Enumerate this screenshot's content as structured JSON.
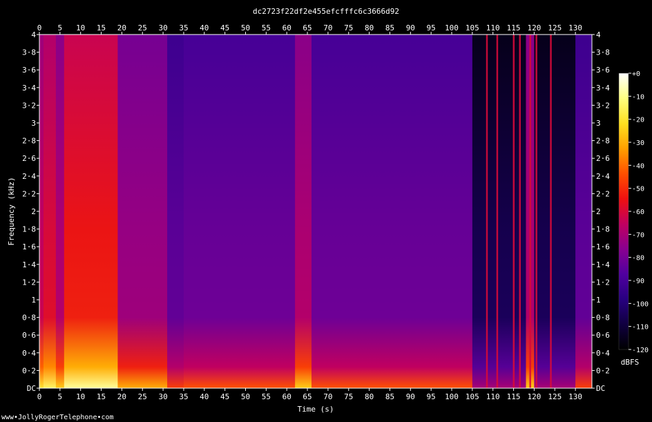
{
  "chart_data": {
    "type": "heatmap",
    "title": "dc2723f22df2e455efcfffc6c3666d92",
    "xlabel": "Time (s)",
    "ylabel": "Frequency (kHz)",
    "xlim": [
      0,
      134
    ],
    "ylim": [
      0,
      4
    ],
    "x_ticks": [
      0,
      5,
      10,
      15,
      20,
      25,
      30,
      35,
      40,
      45,
      50,
      55,
      60,
      65,
      70,
      75,
      80,
      85,
      90,
      95,
      100,
      105,
      110,
      115,
      120,
      125,
      130
    ],
    "y_ticks": [
      {
        "value": 0,
        "label": "DC"
      },
      {
        "value": 0.2,
        "label": "0·2"
      },
      {
        "value": 0.4,
        "label": "0·4"
      },
      {
        "value": 0.6,
        "label": "0·6"
      },
      {
        "value": 0.8,
        "label": "0·8"
      },
      {
        "value": 1.0,
        "label": "1"
      },
      {
        "value": 1.2,
        "label": "1·2"
      },
      {
        "value": 1.4,
        "label": "1·4"
      },
      {
        "value": 1.6,
        "label": "1·6"
      },
      {
        "value": 1.8,
        "label": "1·8"
      },
      {
        "value": 2.0,
        "label": "2"
      },
      {
        "value": 2.2,
        "label": "2·2"
      },
      {
        "value": 2.4,
        "label": "2·4"
      },
      {
        "value": 2.6,
        "label": "2·6"
      },
      {
        "value": 2.8,
        "label": "2·8"
      },
      {
        "value": 3.0,
        "label": "3"
      },
      {
        "value": 3.2,
        "label": "3·2"
      },
      {
        "value": 3.4,
        "label": "3·4"
      },
      {
        "value": 3.6,
        "label": "3·6"
      },
      {
        "value": 3.8,
        "label": "3·8"
      },
      {
        "value": 4.0,
        "label": "4"
      }
    ],
    "colorbar": {
      "label": "dBFS",
      "range": [
        -120,
        0
      ],
      "ticks": [
        {
          "value": 0,
          "label": "+0"
        },
        {
          "value": -10,
          "label": "-10"
        },
        {
          "value": -20,
          "label": "-20"
        },
        {
          "value": -30,
          "label": "-30"
        },
        {
          "value": -40,
          "label": "-40"
        },
        {
          "value": -50,
          "label": "-50"
        },
        {
          "value": -60,
          "label": "-60"
        },
        {
          "value": -70,
          "label": "-70"
        },
        {
          "value": -80,
          "label": "-80"
        },
        {
          "value": -90,
          "label": "-90"
        },
        {
          "value": -100,
          "label": "-100"
        },
        {
          "value": -110,
          "label": "-110"
        },
        {
          "value": -120,
          "label": "-120"
        }
      ],
      "colors": [
        "#ffffff",
        "#ffff80",
        "#ffe020",
        "#ffa000",
        "#ff5000",
        "#f01010",
        "#c00060",
        "#8a0090",
        "#5000a0",
        "#280080",
        "#100040",
        "#000000"
      ]
    },
    "segments": [
      {
        "t0": 0,
        "t1": 1,
        "level": -60
      },
      {
        "t0": 1,
        "t1": 4,
        "level": -55
      },
      {
        "t0": 4,
        "t1": 6,
        "level": -65
      },
      {
        "t0": 6,
        "t1": 19,
        "level": -50
      },
      {
        "t0": 19,
        "t1": 31,
        "level": -70
      },
      {
        "t0": 31,
        "t1": 35,
        "level": -85
      },
      {
        "t0": 35,
        "t1": 62,
        "level": -82
      },
      {
        "t0": 62,
        "t1": 66,
        "level": -65
      },
      {
        "t0": 66,
        "t1": 105,
        "level": -82
      },
      {
        "t0": 105,
        "t1": 118,
        "level": -108
      },
      {
        "t0": 118,
        "t1": 120,
        "level": -65
      },
      {
        "t0": 120,
        "t1": 130,
        "level": -108
      },
      {
        "t0": 130,
        "t1": 134,
        "level": -85
      }
    ],
    "spikes": [
      108.5,
      111,
      115,
      116.5,
      119,
      120.5,
      124
    ]
  },
  "footer": {
    "watermark": "www•JollyRogerTelephone•com"
  }
}
